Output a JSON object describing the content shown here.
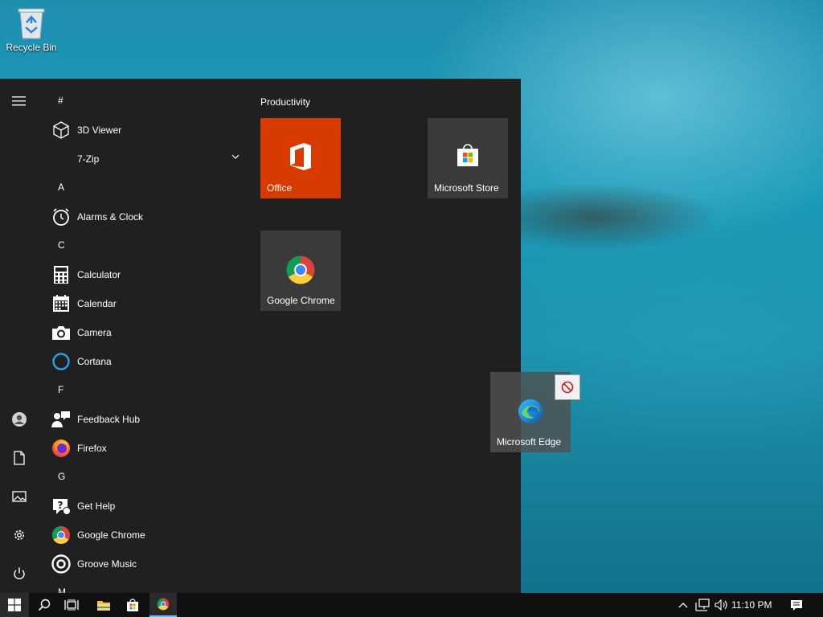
{
  "desktop": {
    "recycle_bin_label": "Recycle Bin"
  },
  "start_menu": {
    "app_list": [
      {
        "type": "header",
        "text": "#"
      },
      {
        "type": "app",
        "name": "3D Viewer",
        "icon": "cube-icon"
      },
      {
        "type": "app",
        "name": "7-Zip",
        "icon": "folder-icon",
        "expandable": true
      },
      {
        "type": "header",
        "text": "A"
      },
      {
        "type": "app",
        "name": "Alarms & Clock",
        "icon": "clock-icon"
      },
      {
        "type": "header",
        "text": "C"
      },
      {
        "type": "app",
        "name": "Calculator",
        "icon": "calculator-icon"
      },
      {
        "type": "app",
        "name": "Calendar",
        "icon": "calendar-icon"
      },
      {
        "type": "app",
        "name": "Camera",
        "icon": "camera-icon"
      },
      {
        "type": "app",
        "name": "Cortana",
        "icon": "cortana-icon"
      },
      {
        "type": "header",
        "text": "F"
      },
      {
        "type": "app",
        "name": "Feedback Hub",
        "icon": "feedback-icon"
      },
      {
        "type": "app",
        "name": "Firefox",
        "icon": "firefox-icon"
      },
      {
        "type": "header",
        "text": "G"
      },
      {
        "type": "app",
        "name": "Get Help",
        "icon": "help-icon"
      },
      {
        "type": "app",
        "name": "Google Chrome",
        "icon": "chrome-icon"
      },
      {
        "type": "app",
        "name": "Groove Music",
        "icon": "groove-icon"
      },
      {
        "type": "header",
        "text": "M"
      }
    ],
    "tile_group_title": "Productivity",
    "tiles": {
      "office": "Office",
      "store": "Microsoft Store",
      "chrome": "Google Chrome"
    },
    "dragging_tile": "Microsoft Edge"
  },
  "taskbar": {
    "clock": "11:10 PM"
  },
  "colors": {
    "start_bg": "#202020",
    "office_tile": "#d83b01",
    "tile_bg": "#3a3a3a",
    "taskbar_bg": "#101010"
  }
}
